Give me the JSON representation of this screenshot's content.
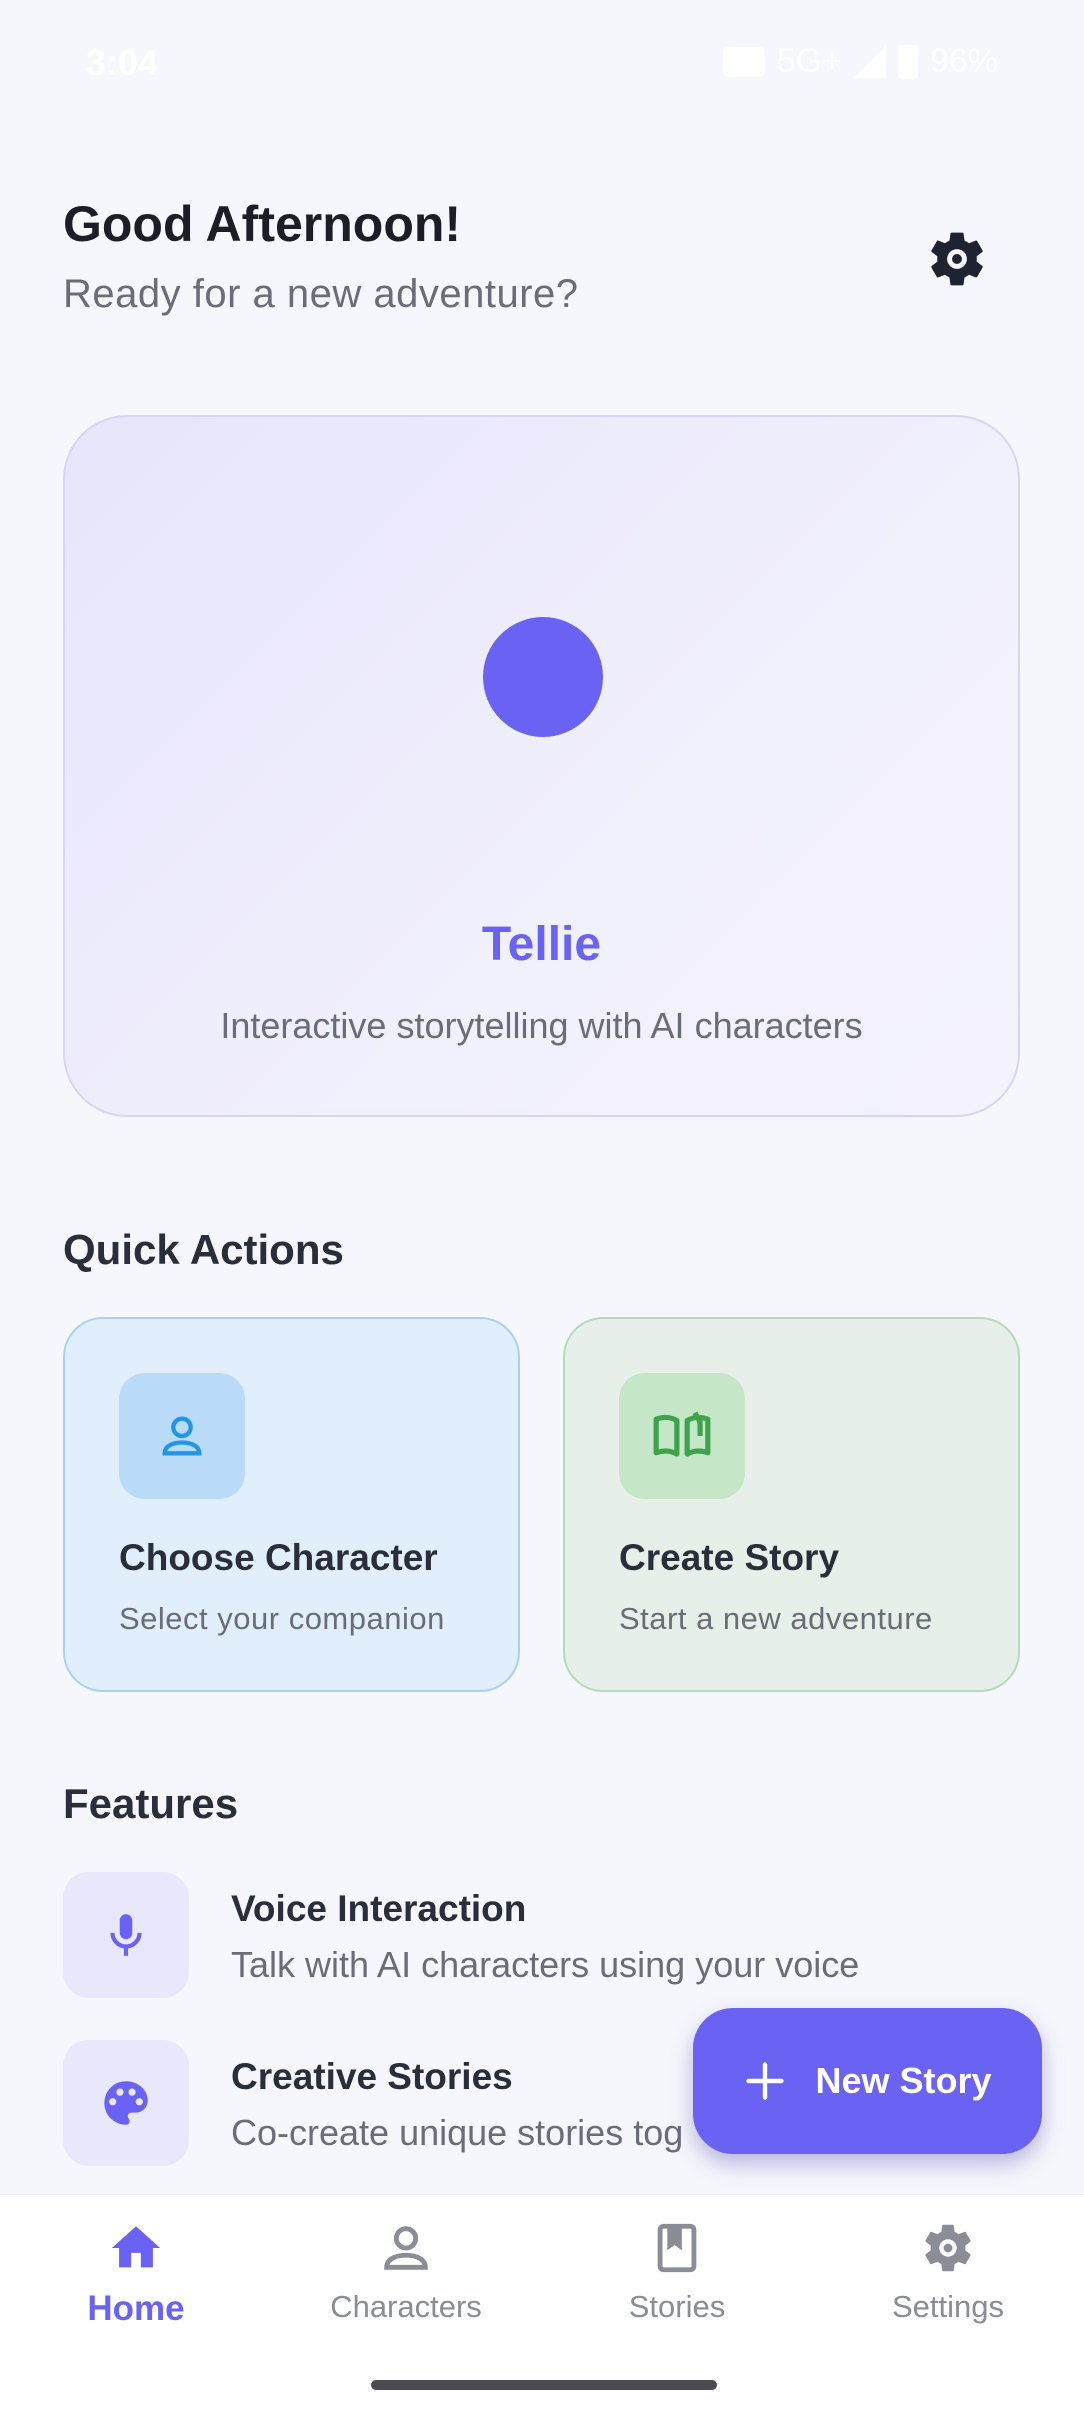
{
  "status_bar": {
    "time": "3:04",
    "network": "5G+",
    "battery": "96%"
  },
  "header": {
    "greeting": "Good Afternoon!",
    "subtitle": "Ready for a new adventure?",
    "settings_icon": "gear-icon"
  },
  "hero": {
    "title": "Tellie",
    "subtitle": "Interactive storytelling with AI characters",
    "accent_color": "#6a62f2"
  },
  "quick_actions": {
    "title": "Quick Actions",
    "items": [
      {
        "title": "Choose Character",
        "subtitle": "Select your companion",
        "icon": "person-icon",
        "color": "#2196e6"
      },
      {
        "title": "Create Story",
        "subtitle": "Start a new adventure",
        "icon": "open-book-icon",
        "color": "#3fa34d"
      }
    ]
  },
  "features": {
    "title": "Features",
    "items": [
      {
        "title": "Voice Interaction",
        "subtitle": "Talk with AI characters using your voice",
        "icon": "microphone-icon"
      },
      {
        "title": "Creative Stories",
        "subtitle": "Co-create unique stories tog",
        "icon": "palette-icon"
      }
    ]
  },
  "fab": {
    "label": "New Story",
    "icon": "plus-icon"
  },
  "bottom_nav": {
    "items": [
      {
        "label": "Home",
        "icon": "home-icon",
        "active": true
      },
      {
        "label": "Characters",
        "icon": "person-icon",
        "active": false
      },
      {
        "label": "Stories",
        "icon": "bookmark-book-icon",
        "active": false
      },
      {
        "label": "Settings",
        "icon": "gear-icon",
        "active": false
      }
    ]
  }
}
